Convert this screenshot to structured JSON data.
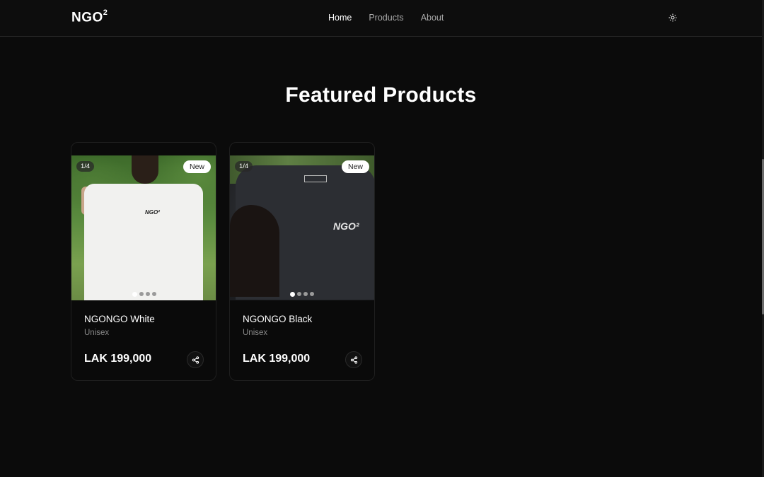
{
  "header": {
    "logo": "NGO",
    "logo_sup": "2",
    "nav": [
      {
        "label": "Home",
        "active": true
      },
      {
        "label": "Products",
        "active": false
      },
      {
        "label": "About",
        "active": false
      }
    ],
    "theme_icon": "sun-icon"
  },
  "main": {
    "title": "Featured Products",
    "products": [
      {
        "name": "NGONGO White",
        "category": "Unisex",
        "price": "LAK 199,000",
        "badge": "New",
        "image_counter": "1/4",
        "image_print": "NGO²",
        "active_slide": 1,
        "slides": 4,
        "share_icon": "share-icon"
      },
      {
        "name": "NGONGO Black",
        "category": "Unisex",
        "price": "LAK 199,000",
        "badge": "New",
        "image_counter": "1/4",
        "image_print": "NGO²",
        "active_slide": 1,
        "slides": 4,
        "share_icon": "share-icon"
      }
    ]
  },
  "colors": {
    "background": "#0b0b0b",
    "text": "#ffffff",
    "muted": "#8a8a8a",
    "badge_bg": "#ffffff"
  }
}
